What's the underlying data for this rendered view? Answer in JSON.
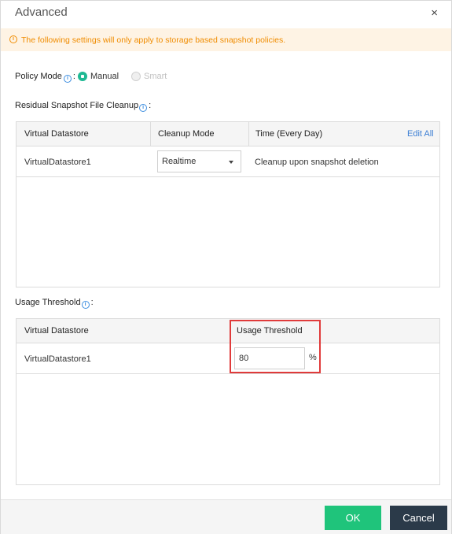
{
  "dialog": {
    "title": "Advanced",
    "close_glyph": "×"
  },
  "notice": {
    "icon": "info-icon",
    "text": "The following settings will only apply to storage based snapshot policies."
  },
  "policy_mode": {
    "label": "Policy Mode",
    "separator": ":",
    "options": [
      {
        "label": "Manual",
        "selected": true,
        "disabled": false
      },
      {
        "label": "Smart",
        "selected": false,
        "disabled": true
      }
    ]
  },
  "cleanup": {
    "label": "Residual Snapshot File Cleanup",
    "separator": ":",
    "columns": [
      "Virtual Datastore",
      "Cleanup Mode",
      "Time (Every Day)"
    ],
    "edit_all": "Edit All",
    "rows": [
      {
        "datastore": "VirtualDatastore1",
        "mode": "Realtime",
        "time": "Cleanup upon snapshot deletion"
      }
    ]
  },
  "usage": {
    "label": "Usage Threshold",
    "separator": ":",
    "columns": [
      "Virtual Datastore",
      "Usage Threshold"
    ],
    "rows": [
      {
        "datastore": "VirtualDatastore1",
        "threshold": "80",
        "unit": "%"
      }
    ]
  },
  "footer": {
    "ok_label": "OK",
    "cancel_label": "Cancel"
  },
  "colors": {
    "accent_green": "#1fc47b",
    "radio_green": "#1fb993",
    "warning_orange": "#f08c00",
    "link_blue": "#3d7fd4",
    "highlight_red": "#e03b3b",
    "dark_button": "#2b3a49"
  }
}
